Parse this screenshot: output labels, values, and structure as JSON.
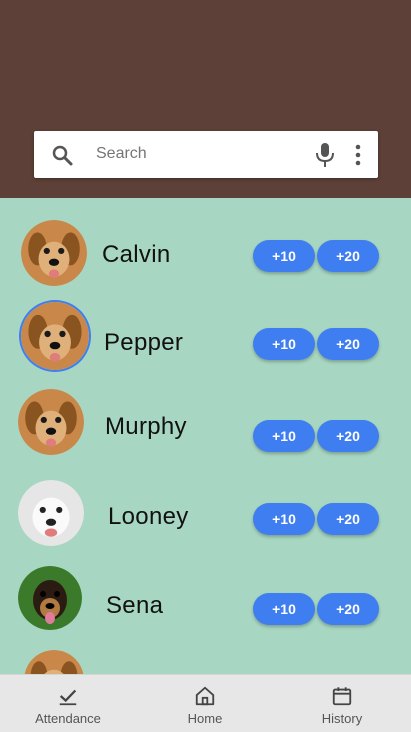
{
  "search": {
    "placeholder": "Search"
  },
  "icons": {
    "search": "search-icon",
    "mic": "mic-icon",
    "more": "more-vert-icon",
    "attendance": "check-icon",
    "home": "home-icon",
    "history": "calendar-icon"
  },
  "colors": {
    "header": "#5d4037",
    "list_bg": "#a7d7c2",
    "accent": "#3f7ef0",
    "nav_bg": "#e7e7e7"
  },
  "dogs": [
    {
      "name": "Calvin",
      "btn10": "+10",
      "btn20": "+20"
    },
    {
      "name": "Pepper",
      "btn10": "+10",
      "btn20": "+20"
    },
    {
      "name": "Murphy",
      "btn10": "+10",
      "btn20": "+20"
    },
    {
      "name": "Looney",
      "btn10": "+10",
      "btn20": "+20"
    },
    {
      "name": "Sena",
      "btn10": "+10",
      "btn20": "+20"
    }
  ],
  "nav": {
    "attendance": "Attendance",
    "home": "Home",
    "history": "History"
  }
}
